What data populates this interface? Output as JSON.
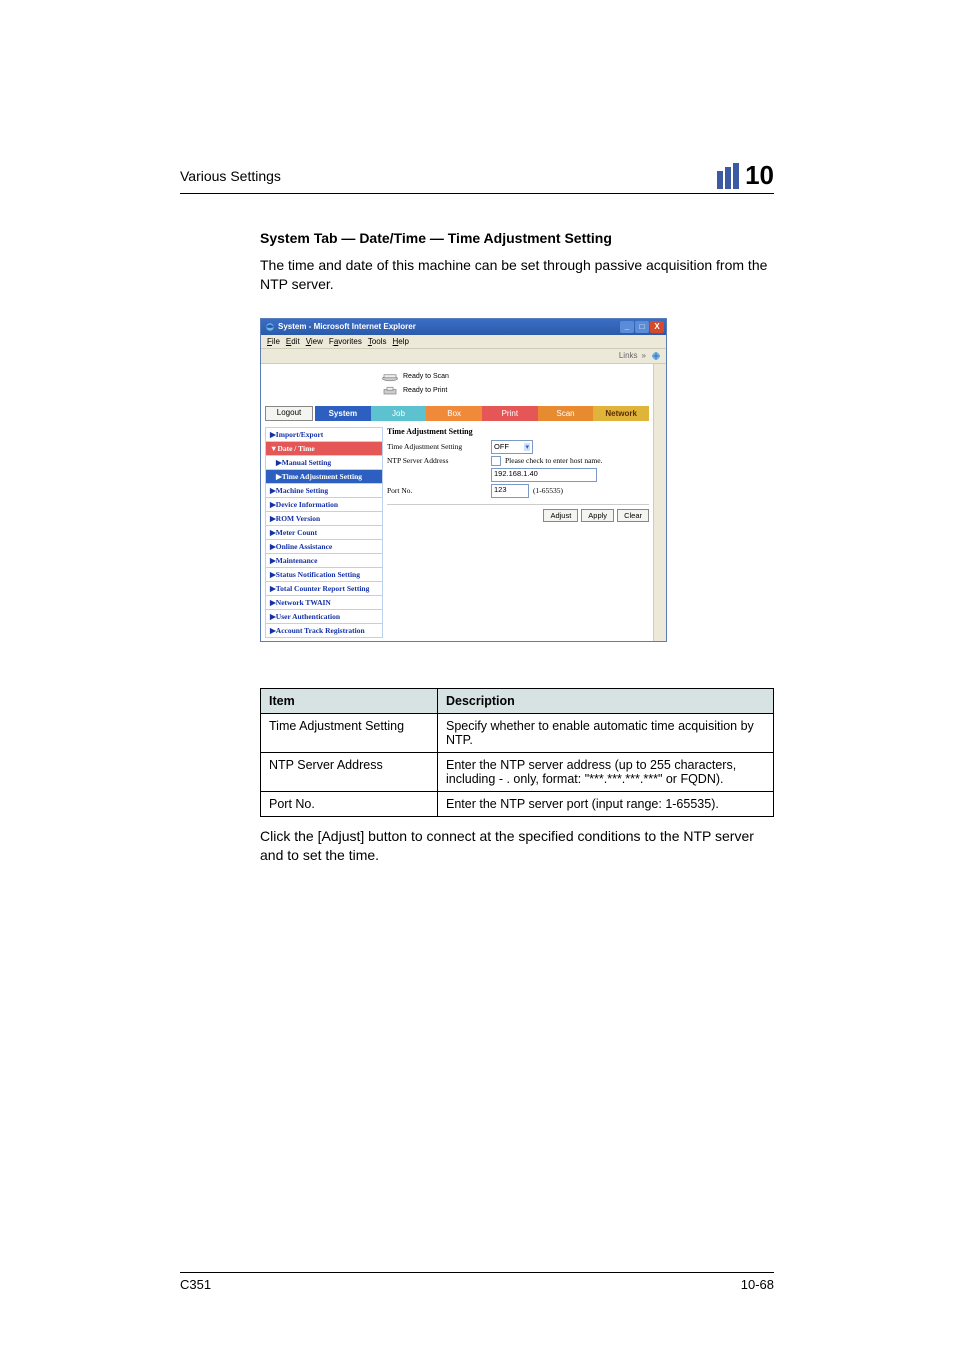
{
  "header": {
    "left": "Various Settings",
    "chapter": "10"
  },
  "section_title": "System Tab — Date/Time — Time Adjustment Setting",
  "intro_para": "The time and date of this machine can be set through passive acquisition from the NTP server.",
  "ie": {
    "title": "System - Microsoft Internet Explorer",
    "menus": [
      "File",
      "Edit",
      "View",
      "Favorites",
      "Tools",
      "Help"
    ],
    "links_label": "Links",
    "status": {
      "scan": "Ready to Scan",
      "print": "Ready to Print"
    },
    "logout": "Logout",
    "tabs": {
      "system": "System",
      "job": "Job",
      "box": "Box",
      "print": "Print",
      "scan": "Scan",
      "network": "Network"
    },
    "sidebar": [
      {
        "label": "Import/Export",
        "type": "top"
      },
      {
        "label": "Date / Time",
        "type": "current-cat"
      },
      {
        "label": "Manual Setting",
        "type": "sub"
      },
      {
        "label": "Time Adjustment Setting",
        "type": "current-sub"
      },
      {
        "label": "Machine Setting",
        "type": "top"
      },
      {
        "label": "Device Information",
        "type": "top"
      },
      {
        "label": "ROM Version",
        "type": "top"
      },
      {
        "label": "Meter Count",
        "type": "top"
      },
      {
        "label": "Online Assistance",
        "type": "top"
      },
      {
        "label": "Maintenance",
        "type": "top"
      },
      {
        "label": "Status Notification Setting",
        "type": "top"
      },
      {
        "label": "Total Counter Report Setting",
        "type": "top"
      },
      {
        "label": "Network TWAIN",
        "type": "top"
      },
      {
        "label": "User Authentication",
        "type": "top"
      },
      {
        "label": "Account Track Registration",
        "type": "top"
      }
    ],
    "form": {
      "heading": "Time Adjustment Setting",
      "rows": {
        "tas_label": "Time Adjustment Setting",
        "tas_value": "OFF",
        "ntp_label": "NTP Server Address",
        "ntp_check_label": "Please check to enter host name.",
        "ntp_value": "192.168.1.40",
        "port_label": "Port No.",
        "port_value": "123",
        "port_range": "(1-65535)"
      },
      "buttons": {
        "adjust": "Adjust",
        "apply": "Apply",
        "clear": "Clear"
      }
    }
  },
  "table": {
    "head": {
      "item": "Item",
      "desc": "Description"
    },
    "rows": [
      {
        "item": "Time Adjustment Setting",
        "desc": "Specify whether to enable automatic time acquisition by NTP."
      },
      {
        "item": "NTP Server Address",
        "desc": "Enter the NTP server address (up to 255 characters, including - . only, format: \"***.***.***.***\" or FQDN)."
      },
      {
        "item": "Port No.",
        "desc": "Enter the NTP server port (input range: 1-65535)."
      }
    ]
  },
  "closing_para": "Click the [Adjust] button to connect at the specified conditions to the NTP server and to set the time.",
  "footer": {
    "left": "C351",
    "right": "10-68"
  }
}
